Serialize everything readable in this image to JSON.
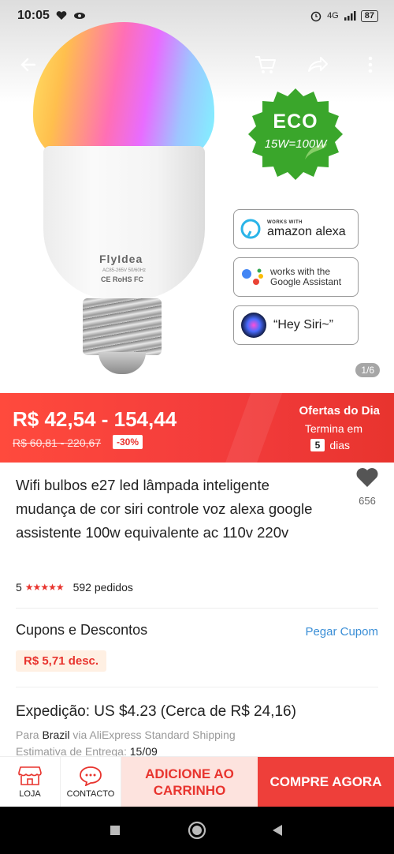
{
  "status_bar": {
    "time": "10:05",
    "network": "4G",
    "battery": "87"
  },
  "gallery": {
    "counter": "1/6"
  },
  "product_image": {
    "brand": "FlyIdea",
    "fine_print": "AC85-265V 50/60Hz",
    "certifications": "CE RoHS FC",
    "eco_title": "ECO",
    "eco_sub": "15W=100W",
    "alexa_small": "WORKS WITH",
    "alexa_big": "amazon alexa",
    "google_text_1": "works with the",
    "google_text_2": "Google Assistant",
    "siri_text": "“Hey Siri~”"
  },
  "price": {
    "range": "R$ 42,54 - 154,44",
    "old_range": "R$ 60,81 - 220,67",
    "discount": "-30%",
    "deal_title": "Ofertas do Dia",
    "deal_sub": "Termina em",
    "days_value": "5",
    "days_label": "dias"
  },
  "product": {
    "title": "Wifi bulbos e27 led lâmpada inteligente mudança de cor siri controle voz alexa google assistente 100w equivalente ac 110v 220v",
    "wish_count": "656",
    "rating": "5",
    "stars": "★★★★★",
    "orders": "592 pedidos"
  },
  "coupons": {
    "title": "Cupons e Descontos",
    "link": "Pegar Cupom",
    "tag": "R$ 5,71 desc."
  },
  "shipping": {
    "title": "Expedição: US $4.23 (Cerca de R$ 24,16)",
    "to_prefix": "Para",
    "country": "Brazil",
    "method": "via AliExpress Standard Shipping",
    "estimate_label": "Estimativa de Entrega:",
    "estimate_date": "15/09"
  },
  "actions": {
    "store": "LOJA",
    "contact": "CONTACTO",
    "add_cart_line1": "ADICIONE AO",
    "add_cart_line2": "CARRINHO",
    "buy_now": "COMPRE AGORA"
  },
  "colors": {
    "accent": "#e8342e",
    "link": "#3a8ed6",
    "eco_green": "#3aa62b"
  }
}
